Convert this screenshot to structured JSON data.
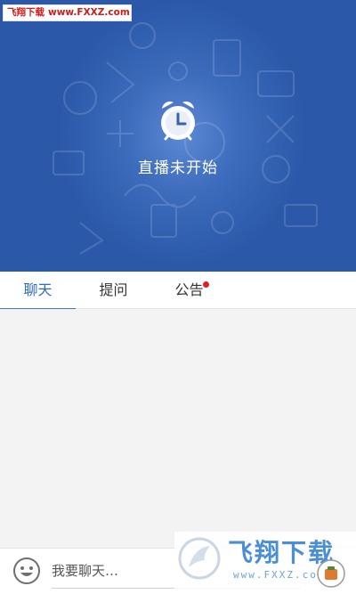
{
  "watermark_top": {
    "brand": "飞翔下载",
    "url": "www.FXXZ.com"
  },
  "live": {
    "status_text": "直播未开始",
    "icon": "alarm-clock-icon"
  },
  "tabs": [
    {
      "label": "聊天",
      "active": true
    },
    {
      "label": "提问",
      "active": false
    },
    {
      "label": "公告",
      "active": false,
      "badge": true
    }
  ],
  "input": {
    "placeholder": "我要聊天…",
    "emoji_icon": "emoji-icon",
    "send_icon": "send-icon"
  },
  "watermark_bottom": {
    "title": "飞翔下载",
    "url": "www.FXXZ.com"
  },
  "colors": {
    "hero": "#2b58a8",
    "accent": "#3a78d4",
    "badge": "#e02020"
  }
}
